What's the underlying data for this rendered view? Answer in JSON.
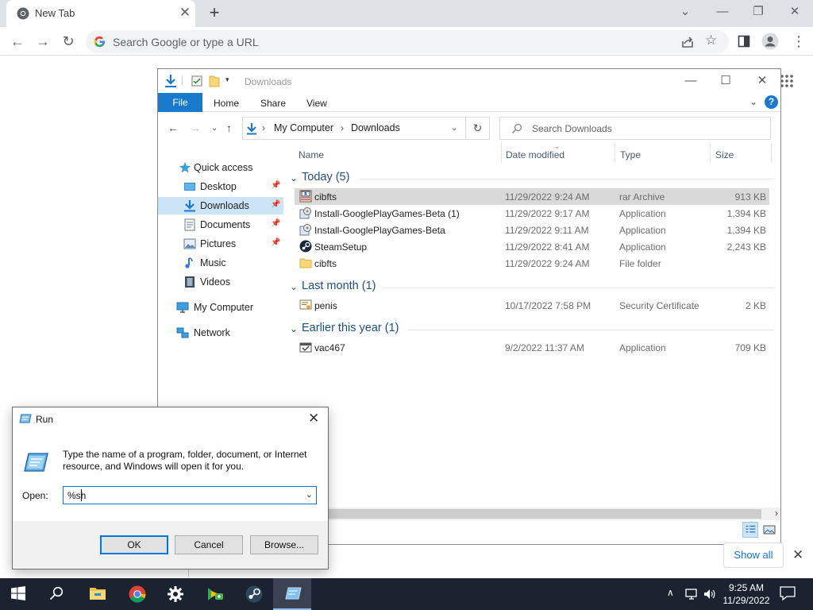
{
  "browser": {
    "tab_title": "New Tab",
    "tab_close": "✕",
    "new_tab": "+",
    "omnibox_placeholder": "Search Google or type a URL",
    "download_bar": {
      "show_all": "Show all",
      "close": "✕"
    }
  },
  "explorer": {
    "title": "Downloads",
    "ribbon": {
      "file": "File",
      "home": "Home",
      "share": "Share",
      "view": "View",
      "help": "?"
    },
    "address": {
      "root": "My Computer",
      "current": "Downloads"
    },
    "search_placeholder": "Search Downloads",
    "sidebar": [
      {
        "label": "Quick access",
        "icon": "star-icon"
      },
      {
        "label": "Desktop",
        "icon": "desktop-icon",
        "pinned": true
      },
      {
        "label": "Downloads",
        "icon": "download-icon",
        "pinned": true,
        "active": true
      },
      {
        "label": "Documents",
        "icon": "documents-icon",
        "pinned": true
      },
      {
        "label": "Pictures",
        "icon": "pictures-icon",
        "pinned": true
      },
      {
        "label": "Music",
        "icon": "music-icon"
      },
      {
        "label": "Videos",
        "icon": "videos-icon"
      },
      {
        "label": "My Computer",
        "icon": "computer-icon"
      },
      {
        "label": "Network",
        "icon": "network-icon"
      }
    ],
    "columns": {
      "name": "Name",
      "date": "Date modified",
      "type": "Type",
      "size": "Size"
    },
    "groups": [
      {
        "label": "Today (5)",
        "files": [
          {
            "name": "cibfts",
            "date": "11/29/2022 9:24 AM",
            "type": "rar Archive",
            "size": "913 KB",
            "icon": "rar-archive-icon",
            "selected": true
          },
          {
            "name": "Install-GooglePlayGames-Beta (1)",
            "date": "11/29/2022 9:17 AM",
            "type": "Application",
            "size": "1,394 KB",
            "icon": "installer-icon"
          },
          {
            "name": "Install-GooglePlayGames-Beta",
            "date": "11/29/2022 9:11 AM",
            "type": "Application",
            "size": "1,394 KB",
            "icon": "installer-icon"
          },
          {
            "name": "SteamSetup",
            "date": "11/29/2022 8:41 AM",
            "type": "Application",
            "size": "2,243 KB",
            "icon": "steam-icon"
          },
          {
            "name": "cibfts",
            "date": "11/29/2022 9:24 AM",
            "type": "File folder",
            "size": "",
            "icon": "folder-icon"
          }
        ]
      },
      {
        "label": "Last month (1)",
        "files": [
          {
            "name": "penis",
            "date": "10/17/2022 7:58 PM",
            "type": "Security Certificate",
            "size": "2 KB",
            "icon": "certificate-icon"
          }
        ]
      },
      {
        "label": "Earlier this year (1)",
        "files": [
          {
            "name": "vac467",
            "date": "9/2/2022 11:37 AM",
            "type": "Application",
            "size": "709 KB",
            "icon": "application-icon"
          }
        ]
      }
    ]
  },
  "run_dialog": {
    "title": "Run",
    "description": "Type the name of a program, folder, document, or Internet resource, and Windows will open it for you.",
    "open_label": "Open:",
    "open_value": "%sh",
    "ok": "OK",
    "cancel": "Cancel",
    "browse": "Browse..."
  },
  "taskbar": {
    "time": "9:25 AM",
    "date": "11/29/2022"
  },
  "colors": {
    "accent": "#1979ca",
    "taskbar": "#1c2330",
    "selection": "#cce4f7",
    "link_blue": "#1a73e8"
  }
}
